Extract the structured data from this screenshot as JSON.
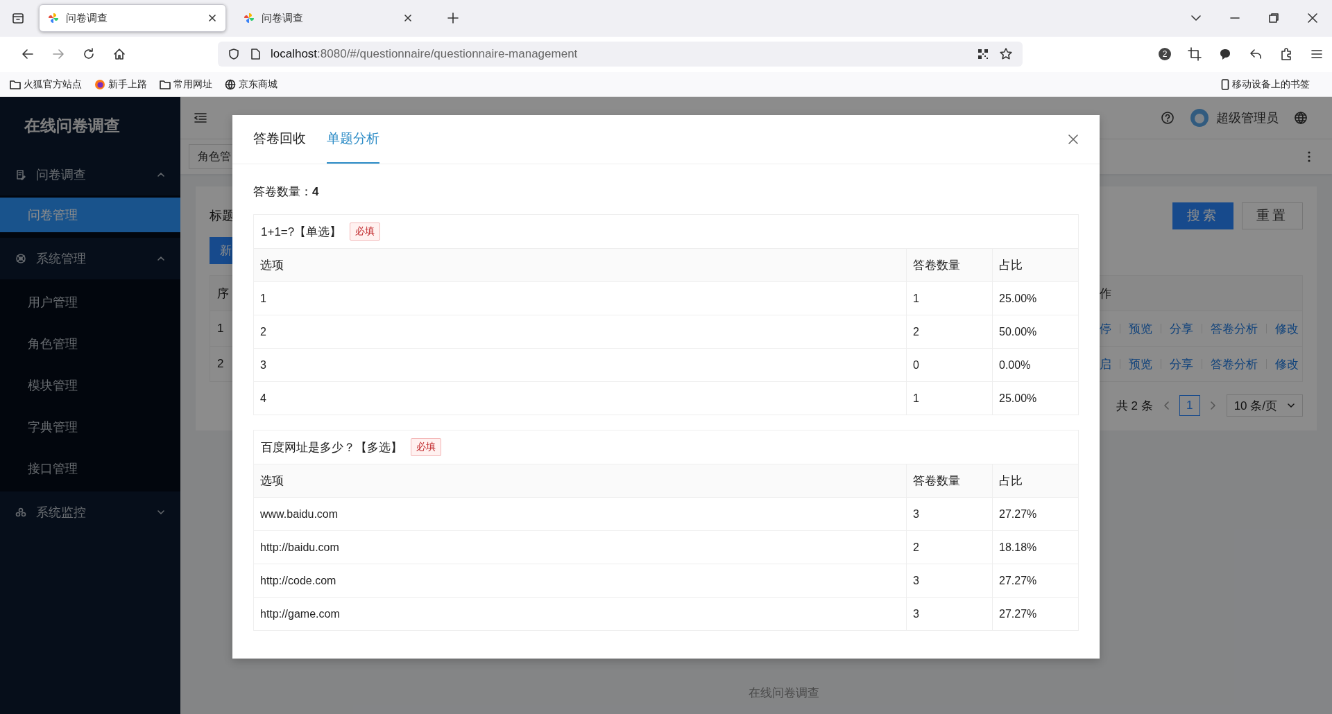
{
  "browser": {
    "tabs": [
      {
        "title": "问卷调查",
        "selected": true
      },
      {
        "title": "问卷调查",
        "selected": false
      }
    ],
    "address": {
      "host": "localhost",
      "path": ":8080/#/questionnaire/questionnaire-management"
    },
    "notification_count": "2",
    "bookmarks": [
      {
        "label": "火狐官方站点",
        "kind": "folder"
      },
      {
        "label": "新手上路",
        "kind": "guide"
      },
      {
        "label": "常用网址",
        "kind": "folder"
      },
      {
        "label": "京东商城",
        "kind": "site"
      }
    ],
    "mobile_bookmarks": "移动设备上的书签"
  },
  "sidebar": {
    "title": "在线问卷调查",
    "menu": [
      {
        "label": "问卷调查",
        "expanded": true,
        "children": [
          {
            "label": "问卷管理",
            "selected": true
          }
        ]
      },
      {
        "label": "系统管理",
        "expanded": true,
        "children": [
          {
            "label": "用户管理",
            "selected": false
          },
          {
            "label": "角色管理",
            "selected": false
          },
          {
            "label": "模块管理",
            "selected": false
          },
          {
            "label": "字典管理",
            "selected": false
          },
          {
            "label": "接口管理",
            "selected": false
          }
        ]
      },
      {
        "label": "系统监控",
        "expanded": false
      }
    ]
  },
  "header": {
    "user": "超级管理员"
  },
  "tags": [
    {
      "label": "角色管"
    }
  ],
  "content": {
    "filter_label": "标题",
    "buttons": [
      {
        "label": "搜索",
        "kind": "primary"
      },
      {
        "label": "重置",
        "kind": "default"
      }
    ],
    "new_button": "新",
    "table": {
      "columns": [
        "序",
        "作"
      ],
      "rows": [
        {
          "column_1": "1",
          "actions": [
            "停",
            "预览",
            "分享",
            "答卷分析",
            "修改"
          ]
        },
        {
          "column_1": "2",
          "actions": [
            "启",
            "预览",
            "分享",
            "答卷分析",
            "修改"
          ]
        }
      ]
    },
    "pagination": {
      "total": "共 2 条",
      "pages": [
        {
          "label": "1",
          "selected": true
        }
      ],
      "page_size": "10 条/页"
    }
  },
  "footer": "在线问卷调查",
  "modal": {
    "tabs": [
      {
        "label": "答卷回收",
        "selected": false
      },
      {
        "label": "单题分析",
        "selected": true
      }
    ],
    "count": "答卷数量：**4**",
    "questions": [
      {
        "title": "1+1=?【单选】",
        "tag": "必填",
        "columns": [
          "选项",
          "答卷数量",
          "占比"
        ],
        "rows": [
          [
            "1",
            "1",
            "25.00%"
          ],
          [
            "2",
            "2",
            "50.00%"
          ],
          [
            "3",
            "0",
            "0.00%"
          ],
          [
            "4",
            "1",
            "25.00%"
          ]
        ]
      },
      {
        "title": "百度网址是多少？【多选】",
        "tag": "必填",
        "columns": [
          "选项",
          "答卷数量",
          "占比"
        ],
        "rows": [
          [
            "www.baidu.com",
            "3",
            "27.27%"
          ],
          [
            "http://baidu.com",
            "2",
            "18.18%"
          ],
          [
            "http://code.com",
            "3",
            "27.27%"
          ],
          [
            "http://game.com",
            "3",
            "27.27%"
          ]
        ]
      }
    ]
  }
}
